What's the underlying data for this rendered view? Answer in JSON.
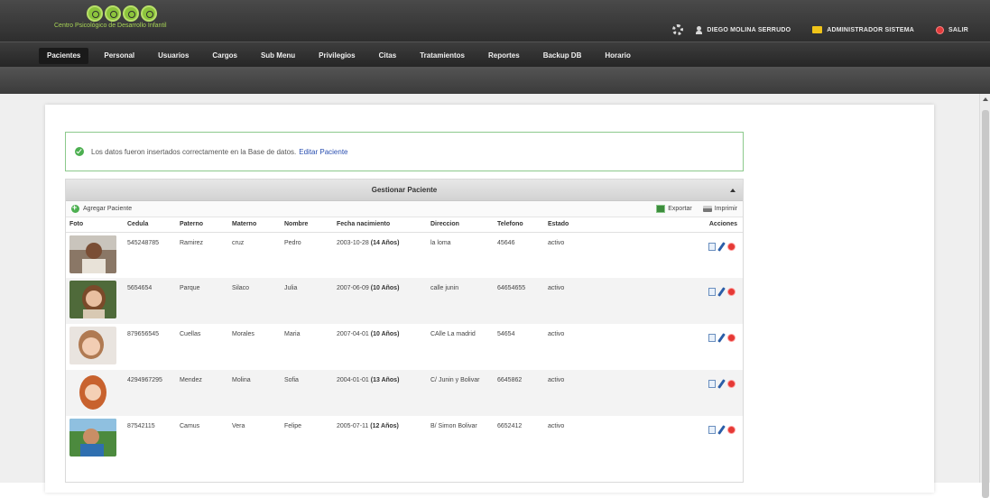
{
  "header": {
    "logo_text": "Centro Psicológico de Desarrollo Infantil",
    "user_name": "DIEGO MOLINA SERRUDO",
    "role": "ADMINISTRADOR SISTEMA",
    "logout_label": "SALIR"
  },
  "nav": {
    "items": [
      "Pacientes",
      "Personal",
      "Usuarios",
      "Cargos",
      "Sub Menu",
      "Privilegios",
      "Citas",
      "Tratamientos",
      "Reportes",
      "Backup DB",
      "Horario"
    ],
    "active_index": 0
  },
  "notice": {
    "message": "Los datos fueron insertados correctamente en la Base de datos.",
    "link": "Editar Paciente"
  },
  "grid": {
    "title": "Gestionar Paciente",
    "add_label": "Agregar Paciente",
    "export_label": "Exportar",
    "print_label": "Imprimir",
    "columns": [
      "Foto",
      "Cedula",
      "Paterno",
      "Materno",
      "Nombre",
      "Fecha nacimiento",
      "Direccion",
      "Telefono",
      "Estado",
      "Acciones"
    ],
    "rows": [
      {
        "cedula": "545248785",
        "paterno": "Ramirez",
        "materno": "cruz",
        "nombre": "Pedro",
        "fecha": "2003-10-28",
        "edad": "(14 Años)",
        "direccion": "la loma",
        "telefono": "45646",
        "estado": "activo"
      },
      {
        "cedula": "5654654",
        "paterno": "Parque",
        "materno": "Silaco",
        "nombre": "Julia",
        "fecha": "2007-06-09",
        "edad": "(10 Años)",
        "direccion": "calle junin",
        "telefono": "64654655",
        "estado": "activo"
      },
      {
        "cedula": "879656545",
        "paterno": "Cuellas",
        "materno": "Morales",
        "nombre": "Maria",
        "fecha": "2007-04-01",
        "edad": "(10 Años)",
        "direccion": "CAlle La madrid",
        "telefono": "54654",
        "estado": "activo"
      },
      {
        "cedula": "4294967295",
        "paterno": "Mendez",
        "materno": "Molina",
        "nombre": "Sofia",
        "fecha": "2004-01-01",
        "edad": "(13 Años)",
        "direccion": "C/ Junin y Bolivar",
        "telefono": "6645862",
        "estado": "activo"
      },
      {
        "cedula": "87542115",
        "paterno": "Camus",
        "materno": "Vera",
        "nombre": "Felipe",
        "fecha": "2005-07-11",
        "edad": "(12 Años)",
        "direccion": "B/ Simon Bolivar",
        "telefono": "6652412",
        "estado": "activo"
      }
    ]
  },
  "colors": {
    "accent_green": "#8cc43c",
    "nav_bg": "#2e2e2e",
    "link": "#2a4fb0",
    "delete": "#e53935"
  }
}
